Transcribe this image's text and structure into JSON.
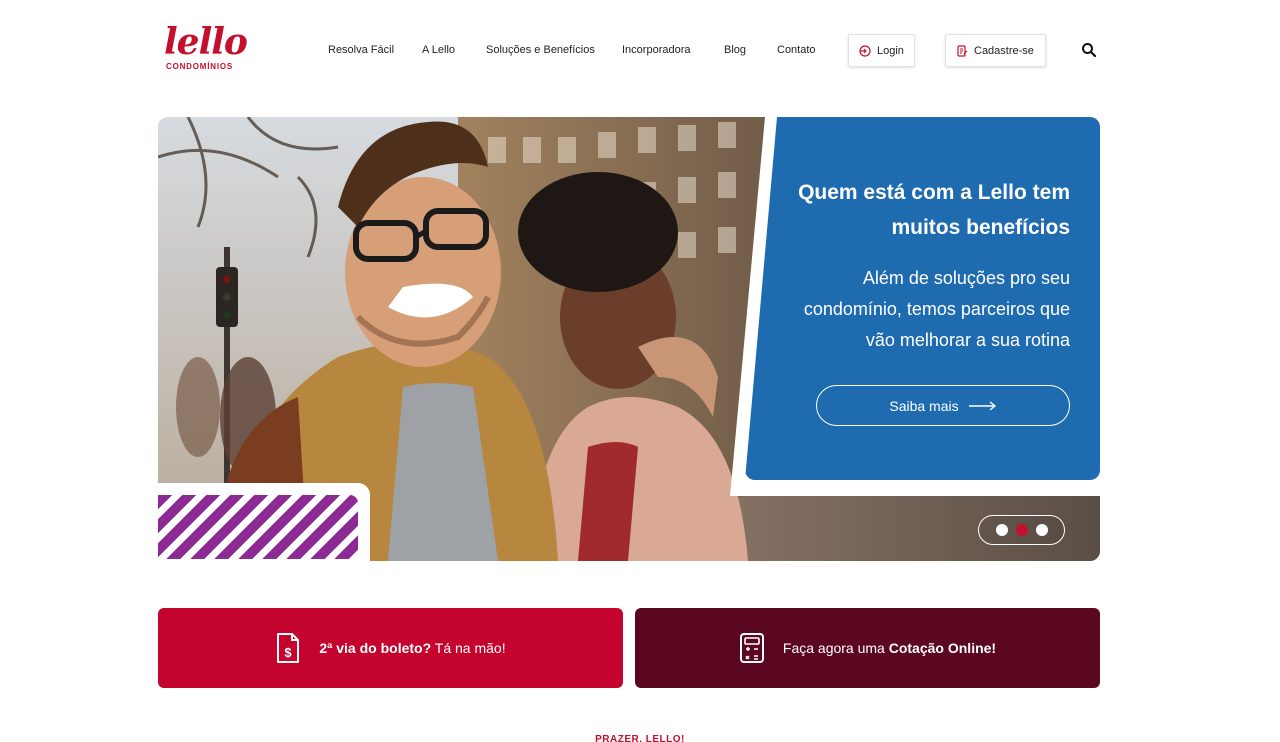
{
  "brand": {
    "name": "lello",
    "subtitle": "CONDOMÍNIOS",
    "color": "#c4102f"
  },
  "nav": {
    "items": [
      {
        "label": "Resolva Fácil"
      },
      {
        "label": "A Lello"
      },
      {
        "label": "Soluções e Benefícios"
      },
      {
        "label": "Incorporadora"
      },
      {
        "label": "Blog"
      },
      {
        "label": "Contato"
      }
    ],
    "login_label": "Login",
    "signup_label": "Cadastre-se",
    "search_icon": "search-icon"
  },
  "hero": {
    "title": "Quem está com a Lello tem muitos benefícios",
    "description": "Além de soluções pro seu condomínio, temos parceiros que vão melhorar a sua rotina",
    "cta_label": "Saiba mais",
    "card_color": "#1f6bb0",
    "carousel": {
      "slides": 3,
      "active_index": 1
    }
  },
  "banners": {
    "boleto": {
      "strong": "2ª via do boleto?",
      "text": " Tá na mão!",
      "color": "#c4042e",
      "icon": "invoice-dollar-icon"
    },
    "cotacao": {
      "text": "Faça agora uma ",
      "strong": "Cotação Online!",
      "color": "#5c0720",
      "icon": "calculator-icon"
    }
  },
  "section": {
    "kicker": "PRAZER, LELLO!"
  }
}
